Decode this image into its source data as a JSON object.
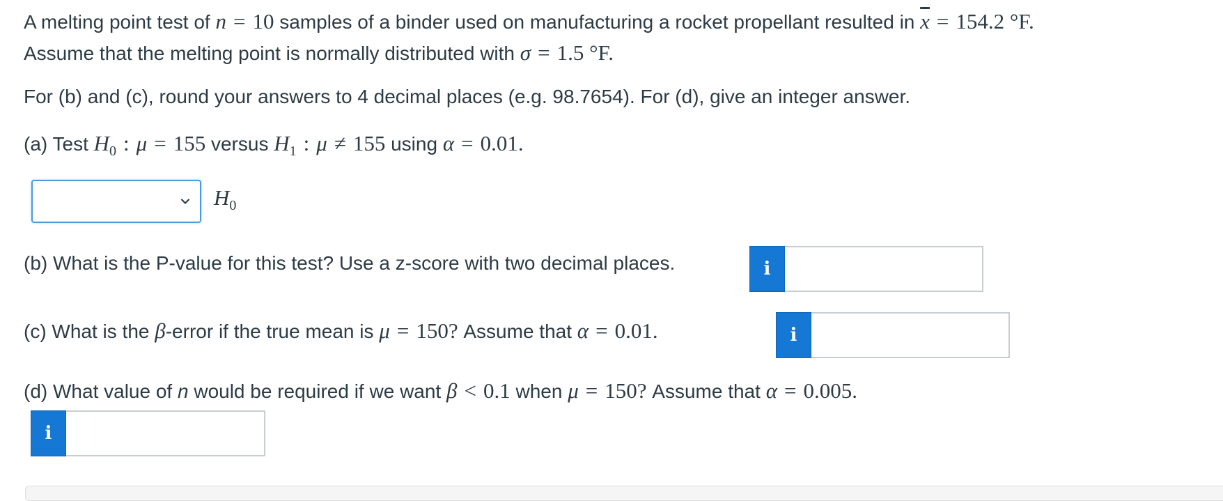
{
  "problem": {
    "line1_a": "A melting point test of",
    "n_var": "n",
    "eq": "=",
    "n_value": "10",
    "line1_b": "samples of a binder used on manufacturing a rocket propellant resulted in",
    "xbar_var": "x",
    "xbar_value": "154.2 °F.",
    "line2_a": "Assume that the melting point is normally distributed with",
    "sigma_var": "σ",
    "sigma_value": "1.5 °F."
  },
  "instructions": "For (b) and (c), round your answers to 4 decimal places (e.g. 98.7654). For (d), give an integer answer.",
  "part_a": {
    "prefix": "(a) Test",
    "h0": "H",
    "h0_sub": "0",
    "colon": ":",
    "mu": "μ",
    "eq": "=",
    "value1": "155",
    "versus": "versus",
    "h1": "H",
    "h1_sub": "1",
    "neq": "≠",
    "value2": "155",
    "using": "using",
    "alpha": "α",
    "alpha_value": "0.01.",
    "dropdown_selected": "",
    "h0_label": "H",
    "h0_label_sub": "0"
  },
  "part_b": {
    "text": "(b) What is the P-value for this test? Use a z-score with two decimal places.",
    "info_icon": "i",
    "value": ""
  },
  "part_c": {
    "prefix": "(c) What is the",
    "beta": "β",
    "mid": "-error if the true mean is",
    "mu": "μ",
    "eq": "=",
    "mu_value": "150",
    "qmark": "?",
    "assume": "Assume that",
    "alpha": "α",
    "alpha_value": "0.01.",
    "info_icon": "i",
    "value": ""
  },
  "part_d": {
    "prefix": "(d) What value of",
    "n": "n",
    "mid": "would be required if we want",
    "beta": "β",
    "lt": "<",
    "beta_value": "0.1",
    "when": "when",
    "mu": "μ",
    "eq": "=",
    "mu_value": "150",
    "qmark": "?",
    "assume": "Assume that",
    "alpha": "α",
    "alpha_value": "0.005.",
    "info_icon": "i",
    "value": ""
  },
  "colors": {
    "accent": "#1478d4",
    "text": "#2d3b45",
    "focus_border": "#4a9bdc"
  }
}
